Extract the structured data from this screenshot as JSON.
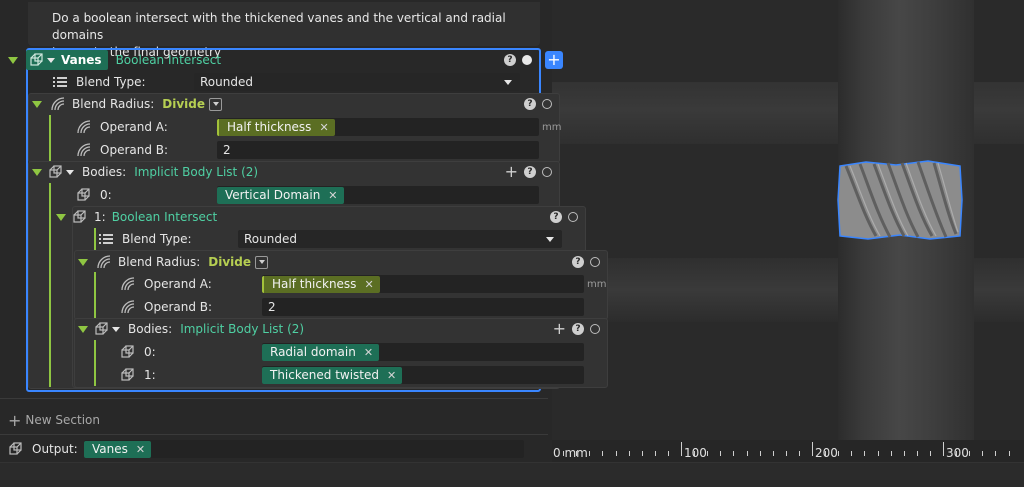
{
  "description": {
    "line1": "Do a boolean intersect with the thickened vanes and the vertical and radial domains",
    "line2": "to create the final geometry"
  },
  "vanes": {
    "name": "Vanes",
    "operation": "Boolean Intersect",
    "blend_type_label": "Blend Type:",
    "blend_type_value": "Rounded",
    "blend_radius_label": "Blend Radius:",
    "blend_radius_mode": "Divide",
    "operand_a_label": "Operand A:",
    "operand_a_value": "Half thickness",
    "operand_a_unit": "mm",
    "operand_b_label": "Operand B:",
    "operand_b_value": "2",
    "bodies_label": "Bodies:",
    "bodies_type": "Implicit Body List (2)",
    "body0_index": "0:",
    "body0_value": "Vertical Domain",
    "body1_index": "1:",
    "body1_operation": "Boolean Intersect",
    "inner": {
      "blend_type_label": "Blend Type:",
      "blend_type_value": "Rounded",
      "blend_radius_label": "Blend Radius:",
      "blend_radius_mode": "Divide",
      "operand_a_label": "Operand A:",
      "operand_a_value": "Half thickness",
      "operand_a_unit": "mm",
      "operand_b_label": "Operand B:",
      "operand_b_value": "2",
      "bodies_label": "Bodies:",
      "bodies_type": "Implicit Body List (2)",
      "b0_index": "0:",
      "b0_value": "Radial domain",
      "b1_index": "1:",
      "b1_value": "Thickened twisted"
    }
  },
  "new_section_label": "New Section",
  "output": {
    "label": "Output:",
    "value": "Vanes"
  },
  "ruler": {
    "labels": [
      "0 mm",
      "100",
      "200",
      "300"
    ]
  },
  "colors": {
    "selection": "#3a86ff",
    "teal_chip": "#1e6f56",
    "olive_chip": "#5b6e23",
    "accent_green": "#4fd0a3",
    "accent_yellow": "#b6cf52"
  }
}
